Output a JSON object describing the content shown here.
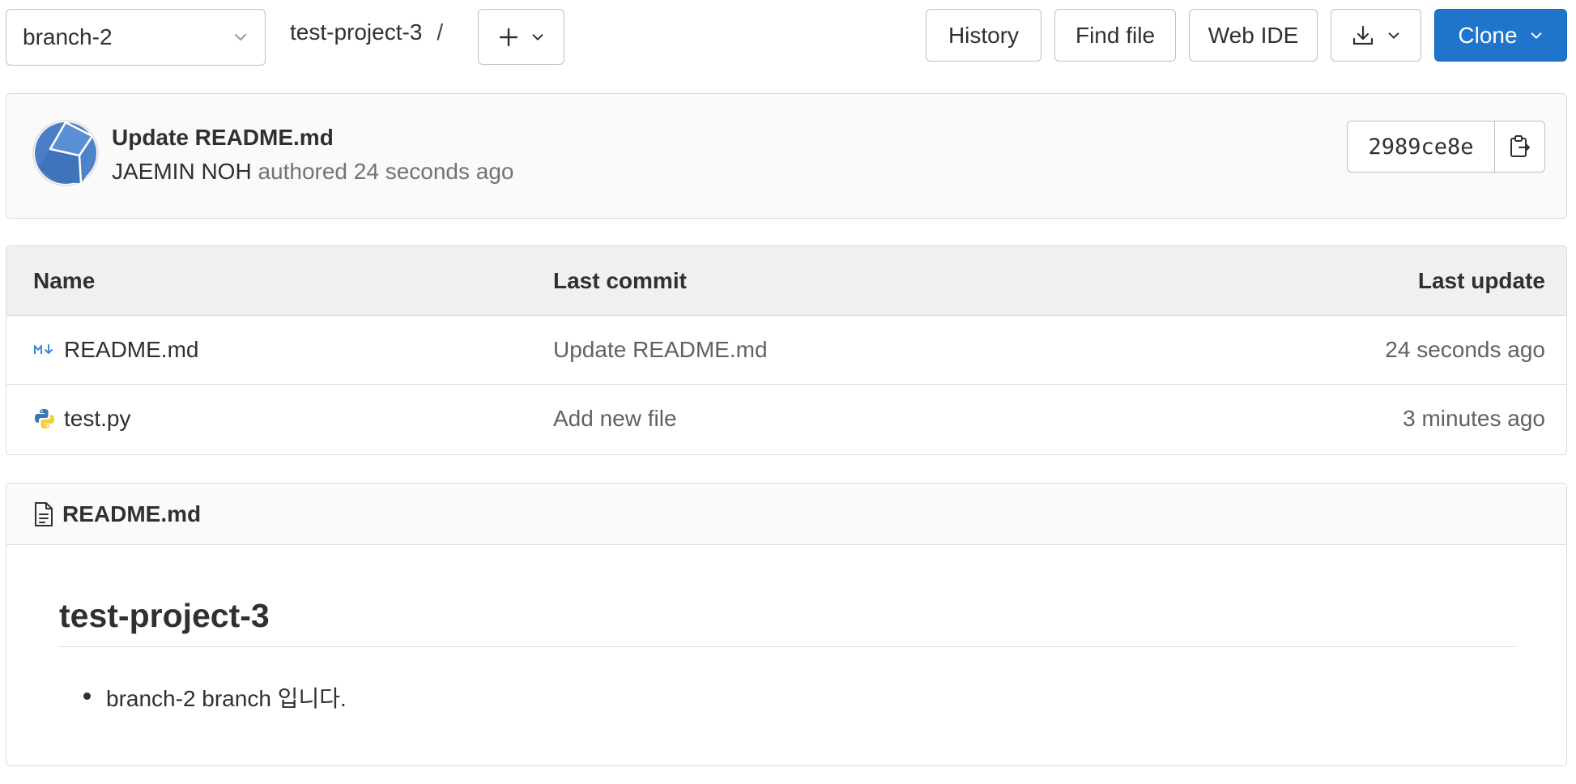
{
  "toolbar": {
    "branch": "branch-2",
    "project": "test-project-3",
    "separator": "/",
    "history_label": "History",
    "find_file_label": "Find file",
    "web_ide_label": "Web IDE",
    "clone_label": "Clone"
  },
  "commit": {
    "title": "Update README.md",
    "author": "JAEMIN NOH",
    "meta": " authored 24 seconds ago",
    "sha": "2989ce8e"
  },
  "table": {
    "headers": {
      "name": "Name",
      "last_commit": "Last commit",
      "last_update": "Last update"
    },
    "rows": [
      {
        "name": "README.md",
        "icon": "markdown-icon",
        "last_commit": "Update README.md",
        "last_update": "24 seconds ago"
      },
      {
        "name": "test.py",
        "icon": "python-icon",
        "last_commit": "Add new file",
        "last_update": "3 minutes ago"
      }
    ]
  },
  "readme": {
    "filename": "README.md",
    "heading": "test-project-3",
    "items": [
      "branch-2 branch 입니다."
    ]
  },
  "colors": {
    "primary": "#1f75cb",
    "border": "#dbdbdb",
    "header_bg": "#f0f0f0",
    "muted_text": "#737278"
  }
}
